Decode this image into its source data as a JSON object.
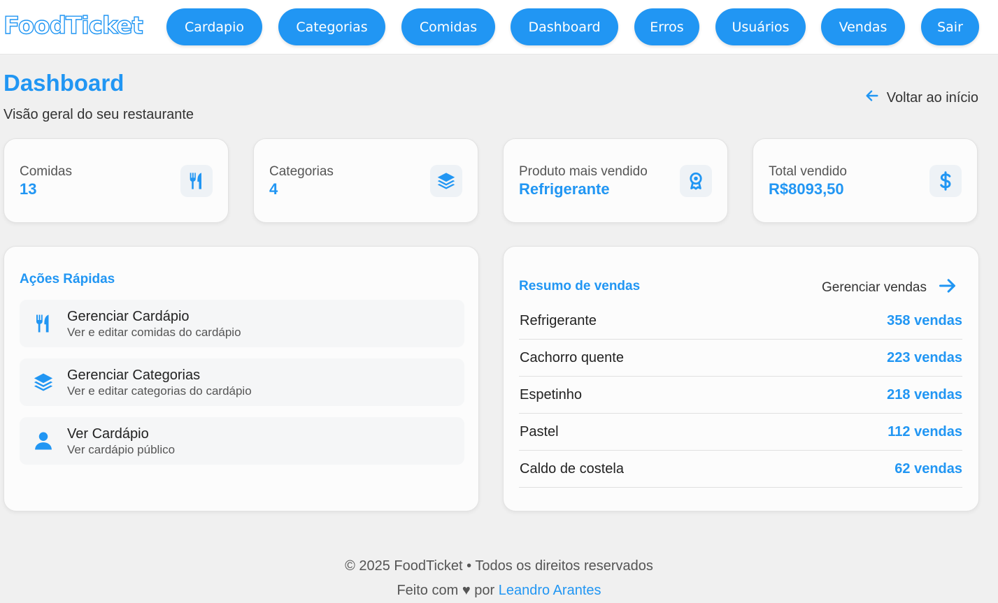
{
  "brand": {
    "logo": "FoodTicket"
  },
  "nav": [
    {
      "label": "Cardapio"
    },
    {
      "label": "Categorias"
    },
    {
      "label": "Comidas"
    },
    {
      "label": "Dashboard"
    },
    {
      "label": "Erros"
    },
    {
      "label": "Usuários"
    },
    {
      "label": "Vendas"
    },
    {
      "label": "Sair"
    }
  ],
  "page": {
    "title": "Dashboard",
    "subtitle": "Visão geral do seu restaurante",
    "back_label": "Voltar ao início"
  },
  "stats": [
    {
      "label": "Comidas",
      "value": "13",
      "icon": "utensils-icon"
    },
    {
      "label": "Categorias",
      "value": "4",
      "icon": "layers-icon"
    },
    {
      "label": "Produto mais vendido",
      "value": "Refrigerante",
      "icon": "award-icon"
    },
    {
      "label": "Total vendido",
      "value": "R$8093,50",
      "icon": "dollar-icon"
    }
  ],
  "quick_actions": {
    "title": "Ações Rápidas",
    "items": [
      {
        "title": "Gerenciar Cardápio",
        "desc": "Ver e editar comidas do cardápio",
        "icon": "utensils-icon"
      },
      {
        "title": "Gerenciar Categorias",
        "desc": "Ver e editar categorias do cardápio",
        "icon": "layers-icon"
      },
      {
        "title": "Ver Cardápio",
        "desc": "Ver cardápio público",
        "icon": "user-icon"
      }
    ]
  },
  "sales_summary": {
    "title": "Resumo de vendas",
    "manage_label": "Gerenciar vendas",
    "rows": [
      {
        "name": "Refrigerante",
        "count": "358 vendas"
      },
      {
        "name": "Cachorro quente",
        "count": "223 vendas"
      },
      {
        "name": "Espetinho",
        "count": "218 vendas"
      },
      {
        "name": "Pastel",
        "count": "112 vendas"
      },
      {
        "name": "Caldo de costela",
        "count": "62 vendas"
      }
    ]
  },
  "footer": {
    "copyright": "© 2025 FoodTicket • Todos os direitos reservados",
    "made_with": "Feito com ♥ por",
    "author": "Leandro Arantes"
  },
  "colors": {
    "primary": "#2196f3",
    "background": "#f0f0f0",
    "card": "#fcfcfc"
  }
}
